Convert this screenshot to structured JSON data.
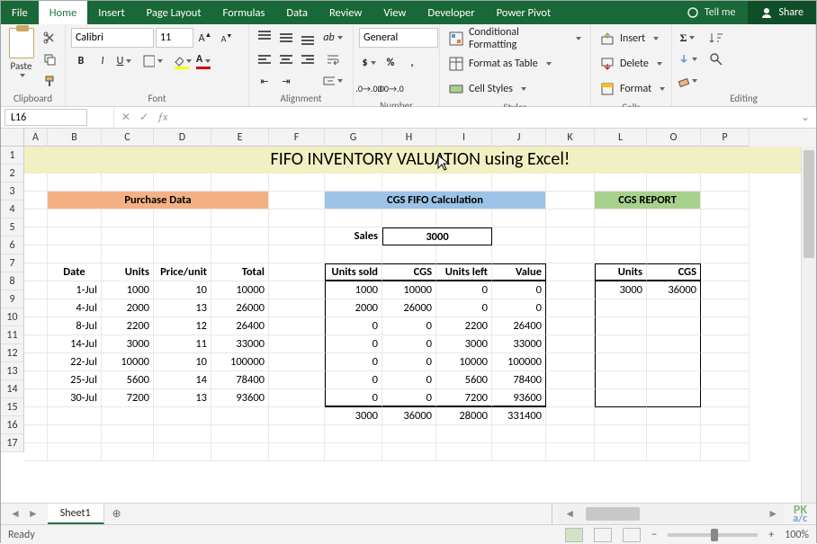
{
  "tabs": [
    "File",
    "Home",
    "Insert",
    "Page Layout",
    "Formulas",
    "Data",
    "Review",
    "View",
    "Developer",
    "Power Pivot"
  ],
  "active_tab": 1,
  "tellme": "Tell me",
  "share": "Share",
  "ribbon": {
    "clipboard": {
      "label": "Clipboard",
      "paste": "Paste"
    },
    "font": {
      "label": "Font",
      "name": "Calibri",
      "size": "11"
    },
    "alignment": {
      "label": "Alignment",
      "wrap": "Wrap",
      "merge": "Merge"
    },
    "number": {
      "label": "Number",
      "format": "General"
    },
    "styles": {
      "label": "Styles",
      "cond": "Conditional Formatting",
      "table": "Format as Table",
      "cell": "Cell Styles"
    },
    "cells": {
      "label": "Cells",
      "insert": "Insert",
      "delete": "Delete",
      "format": "Format"
    },
    "editing": {
      "label": "Editing"
    }
  },
  "namebox": "L16",
  "formula": "",
  "columns": [
    {
      "id": "A",
      "w": 26
    },
    {
      "id": "B",
      "w": 60
    },
    {
      "id": "C",
      "w": 58
    },
    {
      "id": "D",
      "w": 64
    },
    {
      "id": "E",
      "w": 64
    },
    {
      "id": "F",
      "w": 62
    },
    {
      "id": "G",
      "w": 64
    },
    {
      "id": "H",
      "w": 60
    },
    {
      "id": "I",
      "w": 62
    },
    {
      "id": "J",
      "w": 60
    },
    {
      "id": "K",
      "w": 54
    },
    {
      "id": "L",
      "w": 58
    },
    {
      "id": "O",
      "w": 60
    },
    {
      "id": "P",
      "w": 54
    }
  ],
  "rows": [
    1,
    2,
    3,
    4,
    5,
    6,
    7,
    8,
    9,
    10,
    11,
    12,
    13,
    14,
    15,
    16,
    17
  ],
  "title": "FIFO INVENTORY VALUATION using Excel!",
  "headers": {
    "purchase": "Purchase Data",
    "cgs": "CGS FIFO Calculation",
    "report": "CGS REPORT",
    "sales_label": "Sales",
    "sales_value": "3000",
    "purchase_cols": [
      "Date",
      "Units",
      "Price/unit",
      "Total"
    ],
    "calc_cols": [
      "Units sold",
      "CGS",
      "Units left",
      "Value"
    ],
    "report_cols": [
      "Units",
      "CGS"
    ]
  },
  "purchase_data": [
    {
      "date": "1-Jul",
      "units": "1000",
      "price": "10",
      "total": "10000"
    },
    {
      "date": "4-Jul",
      "units": "2000",
      "price": "13",
      "total": "26000"
    },
    {
      "date": "8-Jul",
      "units": "2200",
      "price": "12",
      "total": "26400"
    },
    {
      "date": "14-Jul",
      "units": "3000",
      "price": "11",
      "total": "33000"
    },
    {
      "date": "22-Jul",
      "units": "10000",
      "price": "10",
      "total": "100000"
    },
    {
      "date": "25-Jul",
      "units": "5600",
      "price": "14",
      "total": "78400"
    },
    {
      "date": "30-Jul",
      "units": "7200",
      "price": "13",
      "total": "93600"
    }
  ],
  "calc_data": [
    {
      "sold": "1000",
      "cgs": "10000",
      "left": "0",
      "value": "0"
    },
    {
      "sold": "2000",
      "cgs": "26000",
      "left": "0",
      "value": "0"
    },
    {
      "sold": "0",
      "cgs": "0",
      "left": "2200",
      "value": "26400"
    },
    {
      "sold": "0",
      "cgs": "0",
      "left": "3000",
      "value": "33000"
    },
    {
      "sold": "0",
      "cgs": "0",
      "left": "10000",
      "value": "100000"
    },
    {
      "sold": "0",
      "cgs": "0",
      "left": "5600",
      "value": "78400"
    },
    {
      "sold": "0",
      "cgs": "0",
      "left": "7200",
      "value": "93600"
    }
  ],
  "calc_totals": {
    "sold": "3000",
    "cgs": "36000",
    "left": "28000",
    "value": "331400"
  },
  "report_data": {
    "units": "3000",
    "cgs": "36000"
  },
  "sheet": "Sheet1",
  "status": "Ready",
  "zoom": "100%"
}
